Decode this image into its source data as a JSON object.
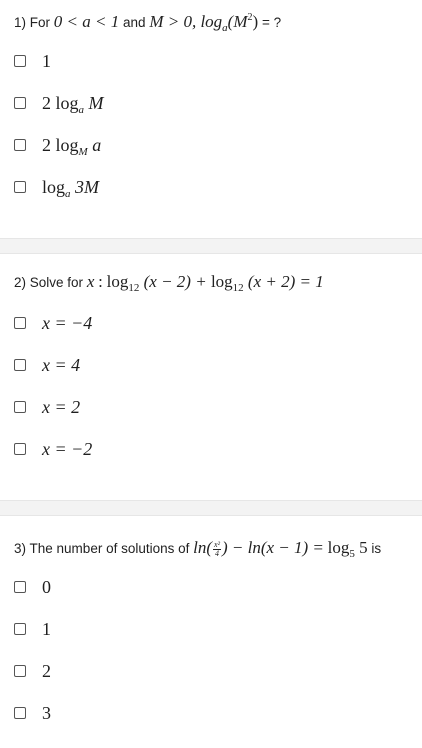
{
  "questions": [
    {
      "number": "1)",
      "prefix": "For",
      "cond1": "0 < a < 1",
      "and": "and",
      "cond2": "M > 0, log",
      "cond2_sub": "a",
      "cond2_arg": "(M",
      "cond2_sup": "2",
      "cond2_close": ")",
      "suffix": "= ?",
      "options": [
        {
          "main": "1",
          "sub": "",
          "tail": ""
        },
        {
          "main": "2 log",
          "sub": "a",
          "tail": "M"
        },
        {
          "main": "2 log",
          "sub": "M",
          "tail": "a"
        },
        {
          "main": "log",
          "sub": "a",
          "tail": "3M"
        }
      ]
    },
    {
      "number": "2)",
      "prefix": "Solve for",
      "var": "x",
      "colon": ":",
      "log1": "log",
      "log1_sub": "12",
      "arg1": "(x − 2) +",
      "log2": "log",
      "log2_sub": "12",
      "arg2": "(x + 2) = 1",
      "options": [
        {
          "label": "x = −4"
        },
        {
          "label": "x = 4"
        },
        {
          "label": "x = 2"
        },
        {
          "label": "x = −2"
        }
      ]
    },
    {
      "number": "3)",
      "prefix": "The number of solutions of",
      "ln1": "ln(",
      "frac_num": "x²",
      "frac_den": "4",
      "ln1_close": ") − ln(x − 1) =",
      "log": "log",
      "log_sub": "5",
      "log_arg": "5",
      "suffix": "is",
      "options": [
        {
          "label": "0"
        },
        {
          "label": "1"
        },
        {
          "label": "2"
        },
        {
          "label": "3"
        }
      ]
    }
  ]
}
